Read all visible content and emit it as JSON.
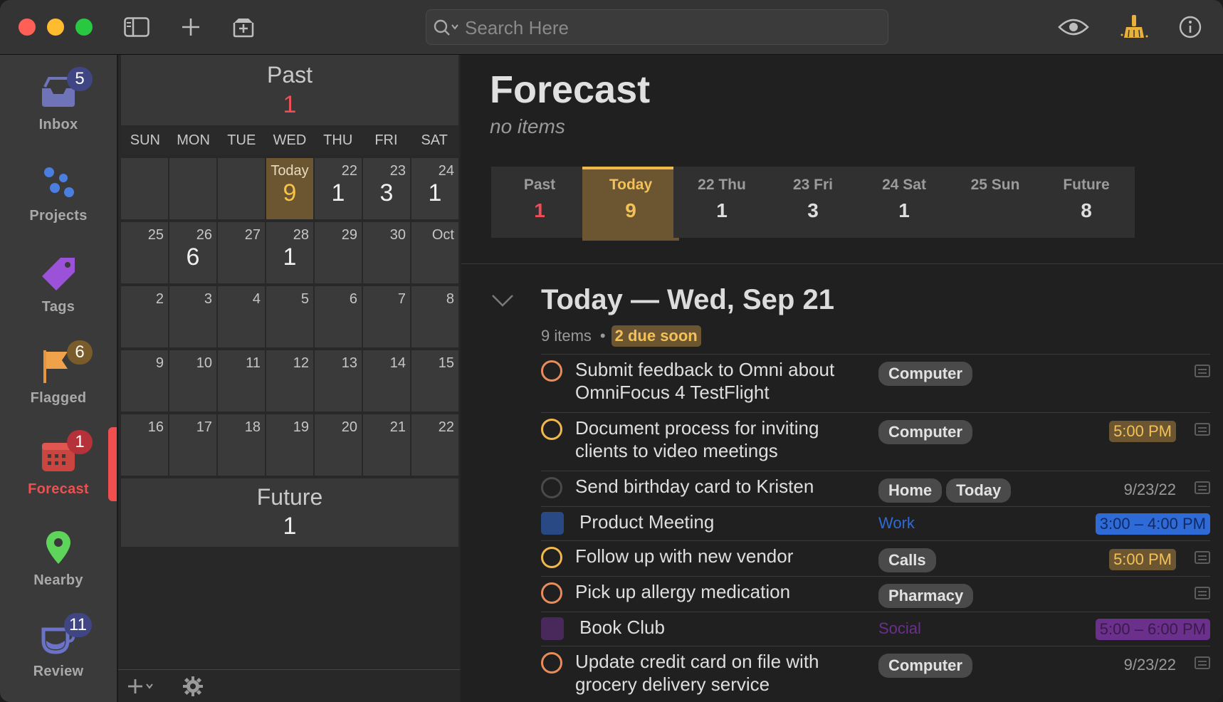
{
  "toolbar": {
    "search_placeholder": "Search Here"
  },
  "sidebar": {
    "items": [
      {
        "label": "Inbox",
        "badge": "5"
      },
      {
        "label": "Projects",
        "badge": ""
      },
      {
        "label": "Tags",
        "badge": ""
      },
      {
        "label": "Flagged",
        "badge": "6"
      },
      {
        "label": "Forecast",
        "badge": "1"
      },
      {
        "label": "Nearby",
        "badge": ""
      },
      {
        "label": "Review",
        "badge": "11"
      }
    ]
  },
  "calendar": {
    "past_label": "Past",
    "past_count": "1",
    "weekdays": [
      "SUN",
      "MON",
      "TUE",
      "WED",
      "THU",
      "FRI",
      "SAT"
    ],
    "today_label": "Today",
    "weeks": [
      [
        {
          "d": "",
          "c": ""
        },
        {
          "d": "",
          "c": ""
        },
        {
          "d": "",
          "c": ""
        },
        {
          "d": "Today",
          "c": "9"
        },
        {
          "d": "22",
          "c": "1"
        },
        {
          "d": "23",
          "c": "3"
        },
        {
          "d": "24",
          "c": "1"
        }
      ],
      [
        {
          "d": "25",
          "c": ""
        },
        {
          "d": "26",
          "c": "6"
        },
        {
          "d": "27",
          "c": ""
        },
        {
          "d": "28",
          "c": "1"
        },
        {
          "d": "29",
          "c": ""
        },
        {
          "d": "30",
          "c": ""
        },
        {
          "d": "Oct",
          "c": ""
        }
      ],
      [
        {
          "d": "2",
          "c": ""
        },
        {
          "d": "3",
          "c": ""
        },
        {
          "d": "4",
          "c": ""
        },
        {
          "d": "5",
          "c": ""
        },
        {
          "d": "6",
          "c": ""
        },
        {
          "d": "7",
          "c": ""
        },
        {
          "d": "8",
          "c": ""
        }
      ],
      [
        {
          "d": "9",
          "c": ""
        },
        {
          "d": "10",
          "c": ""
        },
        {
          "d": "11",
          "c": ""
        },
        {
          "d": "12",
          "c": ""
        },
        {
          "d": "13",
          "c": ""
        },
        {
          "d": "14",
          "c": ""
        },
        {
          "d": "15",
          "c": ""
        }
      ],
      [
        {
          "d": "16",
          "c": ""
        },
        {
          "d": "17",
          "c": ""
        },
        {
          "d": "18",
          "c": ""
        },
        {
          "d": "19",
          "c": ""
        },
        {
          "d": "20",
          "c": ""
        },
        {
          "d": "21",
          "c": ""
        },
        {
          "d": "22",
          "c": ""
        }
      ]
    ],
    "future_label": "Future",
    "future_count": "1"
  },
  "main": {
    "title": "Forecast",
    "subtitle": "no items",
    "strip": [
      {
        "label": "Past",
        "value": "1",
        "color": "#ec4f57"
      },
      {
        "label": "Today",
        "value": "9",
        "color": "#f3c15a"
      },
      {
        "label": "22 Thu",
        "value": "1",
        "color": "#dedede"
      },
      {
        "label": "23 Fri",
        "value": "3",
        "color": "#dedede"
      },
      {
        "label": "24 Sat",
        "value": "1",
        "color": "#dedede"
      },
      {
        "label": "25 Sun",
        "value": "",
        "color": "#dedede"
      },
      {
        "label": "Future",
        "value": "8",
        "color": "#dedede"
      }
    ],
    "section_title": "Today — Wed, Sep 21",
    "section_count": "9 items",
    "section_due_soon": "2 due soon",
    "tasks": [
      {
        "kind": "task",
        "check": "orange",
        "title": "Submit feedback to Omni about OmniFocus 4 TestFlight",
        "tags": [
          "Computer"
        ],
        "due": "",
        "due_soon": false,
        "note": true
      },
      {
        "kind": "task",
        "check": "yellow",
        "title": "Document process for inviting clients to video meetings",
        "tags": [
          "Computer"
        ],
        "due": "5:00 PM",
        "due_soon": true,
        "note": true
      },
      {
        "kind": "task",
        "check": "dark",
        "title": "Send birthday card to Kristen",
        "tags": [
          "Home",
          "Today"
        ],
        "due": "9/23/22",
        "due_soon": false,
        "note": true
      },
      {
        "kind": "event",
        "title": "Product Meeting",
        "calendar": "Work",
        "time": "3:00 – 4:00 PM",
        "color": "#2f6bd6"
      },
      {
        "kind": "task",
        "check": "yellow",
        "title": "Follow up with new vendor",
        "tags": [
          "Calls"
        ],
        "due": "5:00 PM",
        "due_soon": true,
        "note": true
      },
      {
        "kind": "task",
        "check": "orange",
        "title": "Pick up allergy medication",
        "tags": [
          "Pharmacy"
        ],
        "due": "",
        "due_soon": false,
        "note": true
      },
      {
        "kind": "event",
        "title": "Book Club",
        "calendar": "Social",
        "time": "5:00 – 6:00 PM",
        "color": "#6b2f8c"
      },
      {
        "kind": "task",
        "check": "orange",
        "title": "Update credit card on file with grocery delivery service",
        "tags": [
          "Computer"
        ],
        "due": "9/23/22",
        "due_soon": false,
        "note": true
      }
    ]
  }
}
